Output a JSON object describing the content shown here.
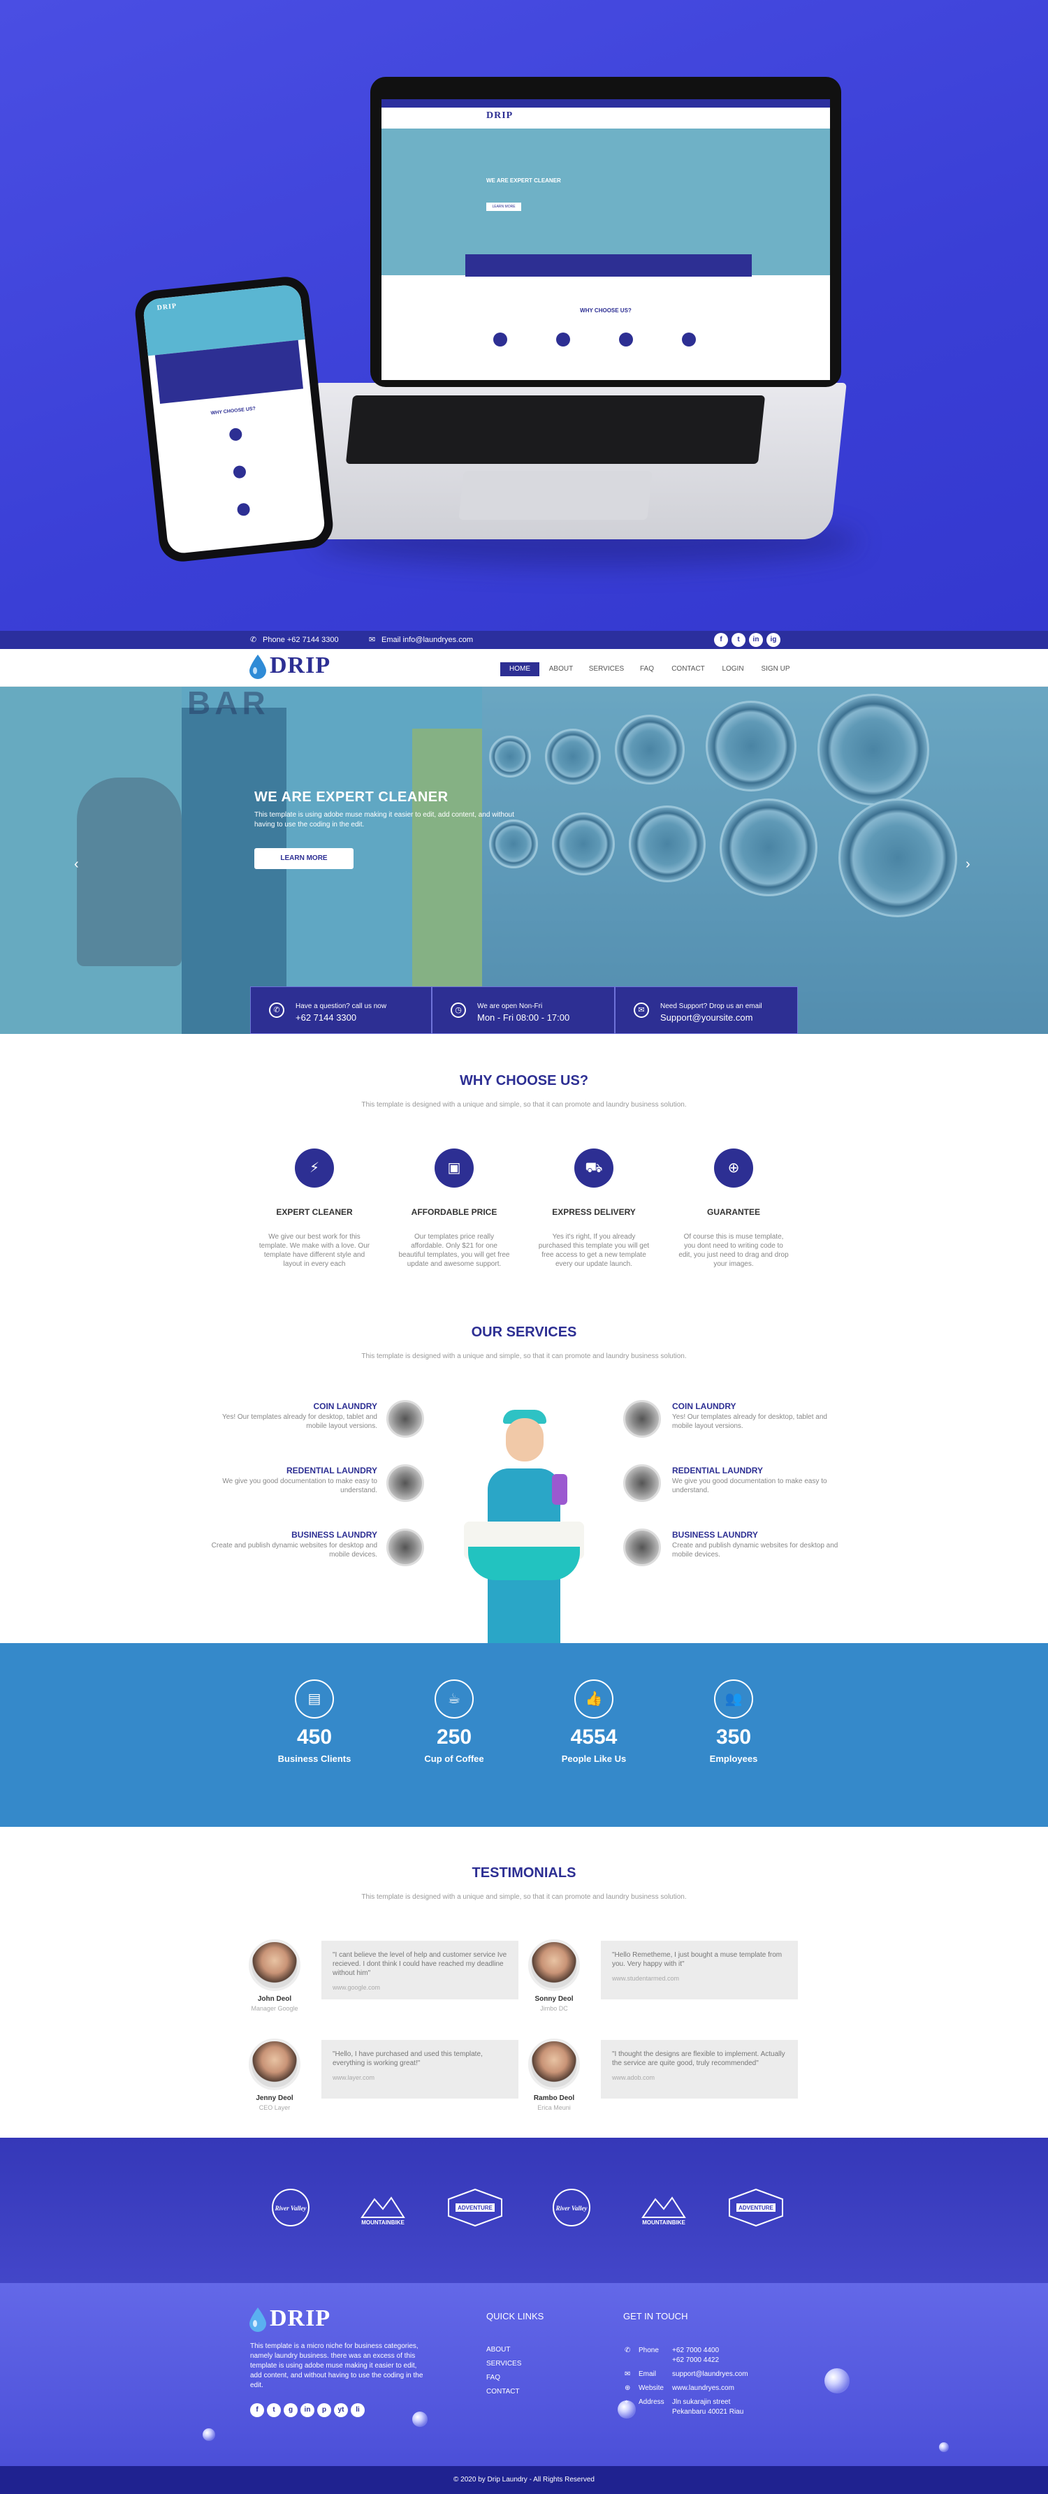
{
  "brand": {
    "name": "DRIP",
    "accent": "#2d2f93",
    "secondary": "#3589ca"
  },
  "mockup": {
    "laptop": {
      "logo": "DRIP",
      "hero_heading": "WE ARE EXPERT CLEANER",
      "button": "LEARN MORE",
      "section": "WHY CHOOSE US?"
    },
    "phone": {
      "logo": "DRIP",
      "section": "WHY CHOOSE US?"
    }
  },
  "topbar": {
    "phone": "Phone +62 7144 3300",
    "email": "Email info@laundryes.com",
    "socials": [
      "f",
      "t",
      "in",
      "ig"
    ]
  },
  "nav": {
    "items": [
      "HOME",
      "ABOUT",
      "SERVICES",
      "FAQ",
      "CONTACT",
      "LOGIN",
      "SIGN UP"
    ],
    "active": "HOME"
  },
  "hero": {
    "sign": "BAR",
    "heading": "WE ARE EXPERT CLEANER",
    "text": "This template is using adobe muse making it easier to edit, add content, and without having to use the coding in the edit.",
    "button": "LEARN MORE",
    "prev": "‹",
    "next": "›",
    "info": [
      {
        "icon": "phone-icon",
        "line1": "Have a question? call us now",
        "line2": "+62 7144 3300"
      },
      {
        "icon": "clock-icon",
        "line1": "We are open Non-Fri",
        "line2": "Mon - Fri 08:00 - 17:00"
      },
      {
        "icon": "mail-icon",
        "line1": "Need Support? Drop us an email",
        "line2": "Support@yoursite.com"
      }
    ]
  },
  "why": {
    "title": "WHY CHOOSE US?",
    "subtitle": "This template is designed with a unique and simple, so that it can promote and laundry business solution.",
    "features": [
      {
        "icon": "bolt-icon",
        "title": "EXPERT CLEANER",
        "text": "We give our best work for this template. We make with a love. Our template have different style and layout in every each"
      },
      {
        "icon": "money-icon",
        "title": "AFFORDABLE PRICE",
        "text": "Our templates price really affordable. Only $21 for one beautiful templates, you will get free update and awesome support."
      },
      {
        "icon": "truck-icon",
        "title": "EXPRESS DELIVERY",
        "text": "Yes it's right, If you already purchased this template you will get free access to get a new template every our update launch."
      },
      {
        "icon": "lifebuoy-icon",
        "title": "GUARANTEE",
        "text": "Of course this is muse template, you dont need to writing code to edit, you just need to drag and drop your images."
      }
    ]
  },
  "services": {
    "title": "OUR SERVICES",
    "subtitle": "This template is designed with a unique and simple, so that it can promote and laundry business solution.",
    "left": [
      {
        "title": "COIN LAUNDRY",
        "text": "Yes! Our templates already for desktop, tablet and mobile layout versions."
      },
      {
        "title": "REDENTIAL LAUNDRY",
        "text": "We give you good documentation to make easy to understand."
      },
      {
        "title": "BUSINESS LAUNDRY",
        "text": "Create and publish dynamic websites for desktop and mobile devices."
      }
    ],
    "right": [
      {
        "title": "COIN LAUNDRY",
        "text": "Yes! Our templates already for desktop, tablet and mobile layout versions."
      },
      {
        "title": "REDENTIAL LAUNDRY",
        "text": "We give you good documentation to make easy to understand."
      },
      {
        "title": "BUSINESS LAUNDRY",
        "text": "Create and publish dynamic websites for desktop and mobile devices."
      }
    ]
  },
  "stats": [
    {
      "icon": "briefcase-icon",
      "value": "450",
      "label": "Business Clients"
    },
    {
      "icon": "coffee-icon",
      "value": "250",
      "label": "Cup of Coffee"
    },
    {
      "icon": "thumbs-up-icon",
      "value": "4554",
      "label": "People Like Us"
    },
    {
      "icon": "users-icon",
      "value": "350",
      "label": "Employees"
    }
  ],
  "testimonials": {
    "title": "TESTIMONIALS",
    "subtitle": "This template is designed with a unique and simple, so that it can promote and laundry business solution.",
    "items": [
      {
        "name": "John Deol",
        "role": "Manager Google",
        "quote": "\"I cant believe the level of help and customer service Ive recieved. I dont think I could have reached my deadline without him\"",
        "link": "www.google.com"
      },
      {
        "name": "Sonny Deol",
        "role": "Jimbo DC",
        "quote": "\"Hello Remetheme, I just bought a muse template from you. Very happy with it\"",
        "link": "www.studentarmed.com"
      },
      {
        "name": "Jenny Deol",
        "role": "CEO Layer",
        "quote": "\"Hello, I have purchased and used this template, everything is working great!\"",
        "link": "www.layer.com"
      },
      {
        "name": "Rambo Deol",
        "role": "Erica Meuni",
        "quote": "\"I thought the designs are flexible to implement. Actually the service are quite good, truly recommended\"",
        "link": "www.adob.com"
      }
    ]
  },
  "brands": [
    "River Valley",
    "MOUNTAINBIKE",
    "ADVENTURE",
    "River Valley",
    "MOUNTAINBIKE",
    "ADVENTURE"
  ],
  "footer": {
    "logo": "DRIP",
    "about": "This template is a micro niche for business categories, namely laundry business. there was an excess of this template is using adobe muse making it easier to edit, add content, and without having to use the coding in the edit.",
    "socials": [
      "f",
      "t",
      "g",
      "in",
      "p",
      "yt",
      "li"
    ],
    "quick_links_title": "QUICK LINKS",
    "quick_links": [
      "ABOUT",
      "SERVICES",
      "FAQ",
      "CONTACT"
    ],
    "contact_title": "GET IN TOUCH",
    "contact": [
      {
        "label": "Phone",
        "value": "+62 7000 4400\n+62 7000 4422"
      },
      {
        "label": "Email",
        "value": "support@laundryes.com"
      },
      {
        "label": "Website",
        "value": "www.laundryes.com"
      },
      {
        "label": "Address",
        "value": "Jln sukarajin street\nPekanbaru 40021 Riau"
      }
    ],
    "copyright": "© 2020 by Drip Laundry - All Rights Reserved"
  }
}
